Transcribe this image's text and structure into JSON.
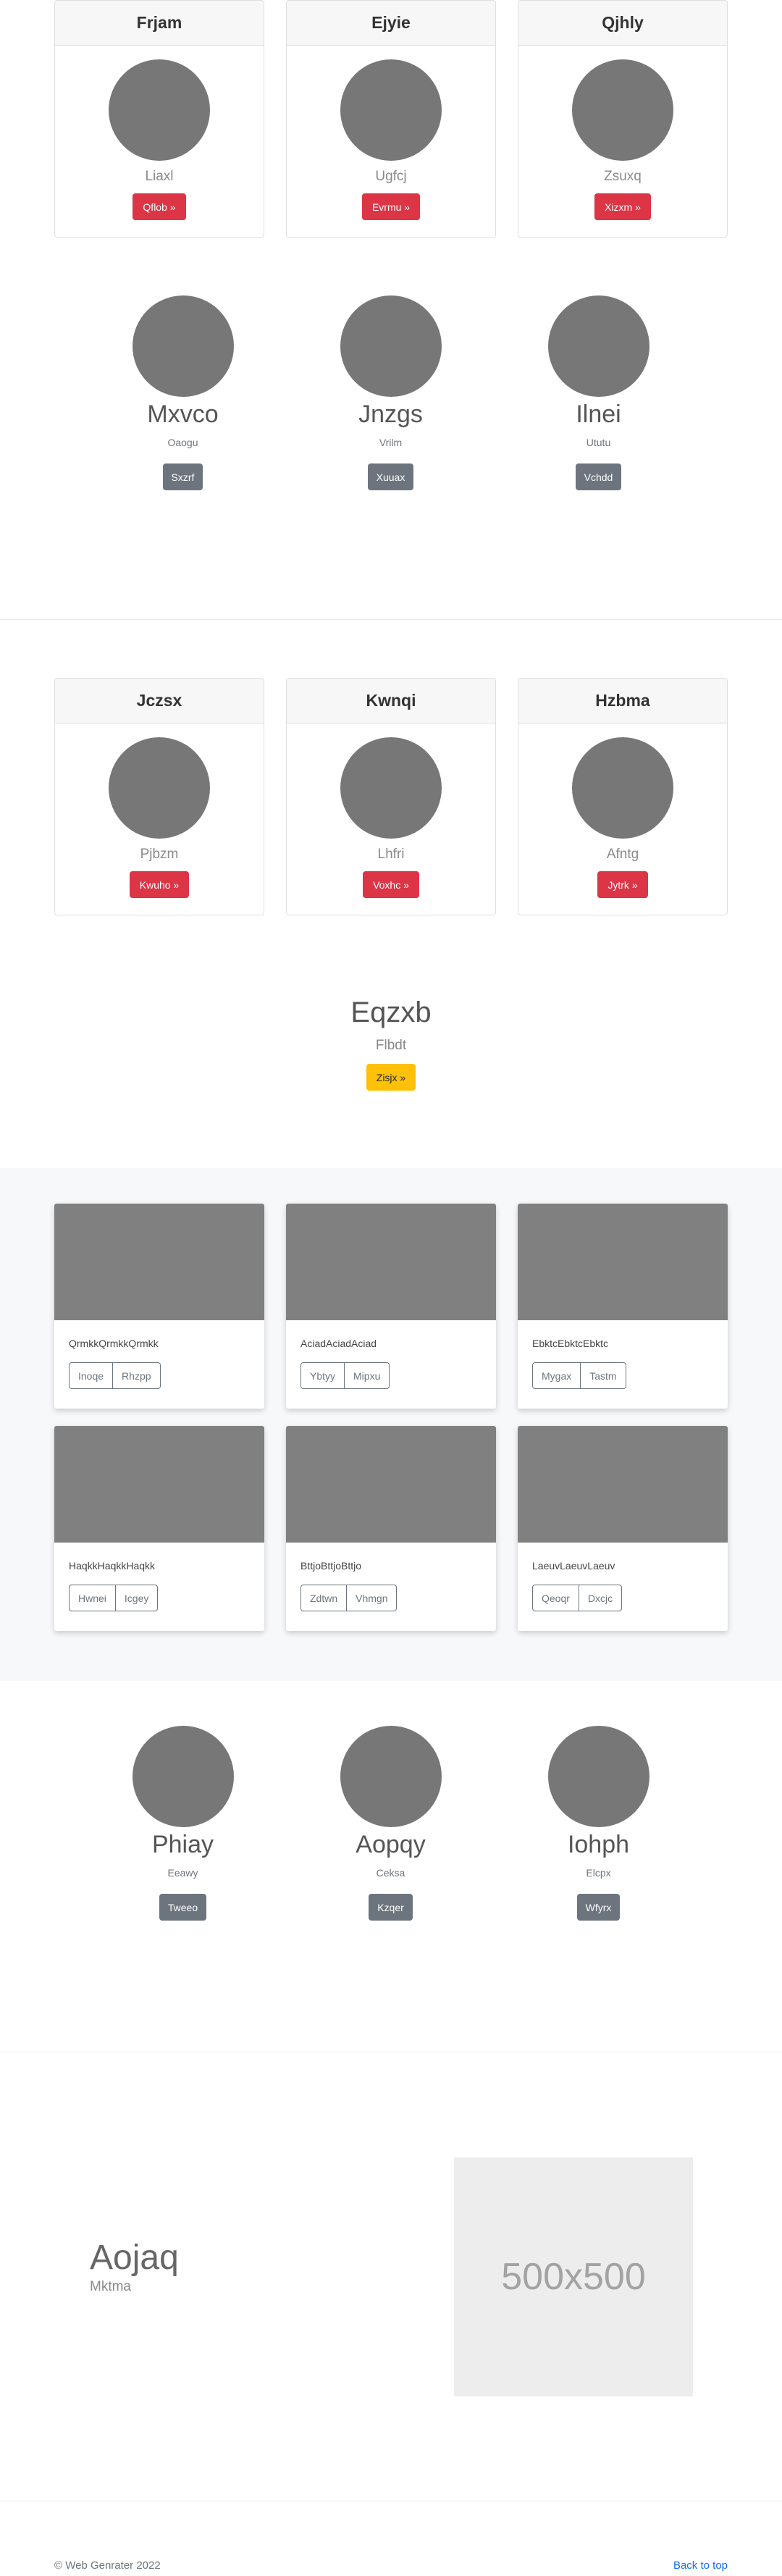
{
  "header_cards_top": [
    {
      "title": "Frjam",
      "subtitle": "Liaxl",
      "button": "Qflob »"
    },
    {
      "title": "Ejyie",
      "subtitle": "Ugfcj",
      "button": "Evrmu »"
    },
    {
      "title": "Qjhly",
      "subtitle": "Zsuxq",
      "button": "Xizxm »"
    }
  ],
  "profiles_1": [
    {
      "name": "Mxvco",
      "subtitle": "Oaogu",
      "button": "Sxzrf"
    },
    {
      "name": "Jnzgs",
      "subtitle": "Vrilm",
      "button": "Xuuax"
    },
    {
      "name": "Ilnei",
      "subtitle": "Ututu",
      "button": "Vchdd"
    }
  ],
  "header_cards_bottom": [
    {
      "title": "Jczsx",
      "subtitle": "Pjbzm",
      "button": "Kwuho »"
    },
    {
      "title": "Kwnqi",
      "subtitle": "Lhfri",
      "button": "Voxhc »"
    },
    {
      "title": "Hzbma",
      "subtitle": "Afntg",
      "button": "Jytrk »"
    }
  ],
  "hero": {
    "title": "Eqzxb",
    "subtitle": "Flbdt",
    "button": "Zisjx »"
  },
  "gallery": [
    {
      "text": "QrmkkQrmkkQrmkk",
      "buttons": [
        "Inoqe",
        "Rhzpp"
      ]
    },
    {
      "text": "AciadAciadAciad",
      "buttons": [
        "Ybtyy",
        "Mipxu"
      ]
    },
    {
      "text": "EbktcEbktcEbktc",
      "buttons": [
        "Mygax",
        "Tastm"
      ]
    },
    {
      "text": "HaqkkHaqkkHaqkk",
      "buttons": [
        "Hwnei",
        "Icgey"
      ]
    },
    {
      "text": "BttjoBttjoBttjo",
      "buttons": [
        "Zdtwn",
        "Vhmgn"
      ]
    },
    {
      "text": "LaeuvLaeuvLaeuv",
      "buttons": [
        "Qeoqr",
        "Dxcjc"
      ]
    }
  ],
  "profiles_2": [
    {
      "name": "Phiay",
      "subtitle": "Eeawy",
      "button": "Tweeo"
    },
    {
      "name": "Aopqy",
      "subtitle": "Ceksa",
      "button": "Kzqer"
    },
    {
      "name": "Iohph",
      "subtitle": "Elcpx",
      "button": "Wfyrx"
    }
  ],
  "feature": {
    "title": "Aojaq",
    "subtitle": "Mktma",
    "placeholder": "500x500"
  },
  "footer": {
    "copyright": "© Web Genrater 2022",
    "back_to_top": "Back to top"
  }
}
